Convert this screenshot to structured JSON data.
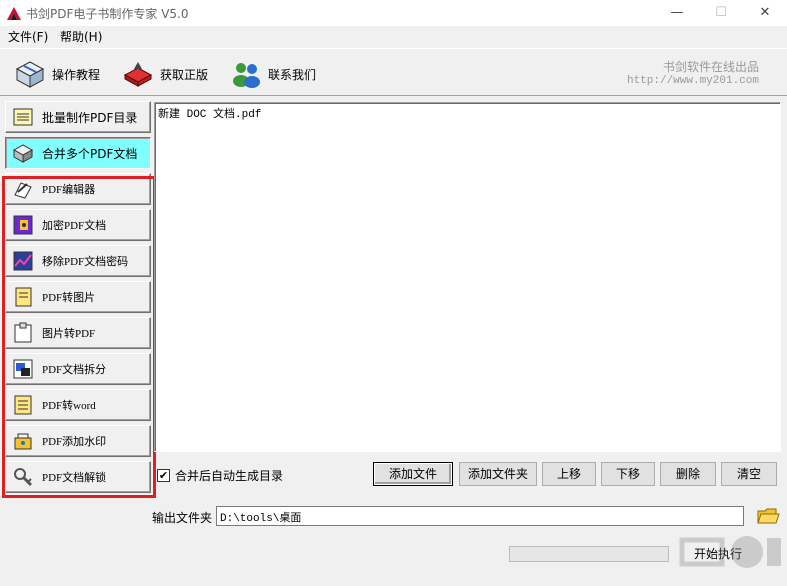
{
  "window": {
    "title": "书剑PDF电子书制作专家 V5.0",
    "minimize": "—",
    "maximize": "☐",
    "close": "✕"
  },
  "menu": {
    "items": [
      "文件(F)",
      "帮助(H)"
    ]
  },
  "toolbar": {
    "tutorial": "操作教程",
    "buy": "获取正版",
    "contact": "联系我们",
    "brand_name": "书剑软件在线出品",
    "brand_url": "http://www.my201.com"
  },
  "nav": {
    "items": [
      {
        "label": "批量制作PDF目录",
        "icon": "list-book-icon"
      },
      {
        "label": "合并多个PDF文档",
        "icon": "merge-icon"
      },
      {
        "label": "PDF编辑器",
        "icon": "edit-icon"
      },
      {
        "label": "加密PDF文档",
        "icon": "encrypt-icon"
      },
      {
        "label": "移除PDF文档密码",
        "icon": "remove-password-icon"
      },
      {
        "label": "PDF转图片",
        "icon": "pdf-to-image-icon"
      },
      {
        "label": "图片转PDF",
        "icon": "image-to-pdf-icon"
      },
      {
        "label": "PDF文档拆分",
        "icon": "split-icon"
      },
      {
        "label": "PDF转word",
        "icon": "pdf-to-word-icon"
      },
      {
        "label": "PDF添加水印",
        "icon": "watermark-icon"
      },
      {
        "label": "PDF文档解锁",
        "icon": "unlock-icon"
      }
    ],
    "active_index": 1
  },
  "file_list": {
    "items": [
      "新建 DOC 文档.pdf"
    ]
  },
  "options": {
    "auto_toc_label": "合并后自动生成目录",
    "auto_toc_checked": true,
    "check_mark": "✔"
  },
  "buttons": {
    "add_file": "添加文件",
    "add_folder": "添加文件夹",
    "move_up": "上移",
    "move_down": "下移",
    "delete": "删除",
    "clear": "清空",
    "start": "开始执行"
  },
  "output": {
    "label": "输出文件夹",
    "value": "D:\\tools\\桌面"
  },
  "progress": {
    "value": 0
  }
}
